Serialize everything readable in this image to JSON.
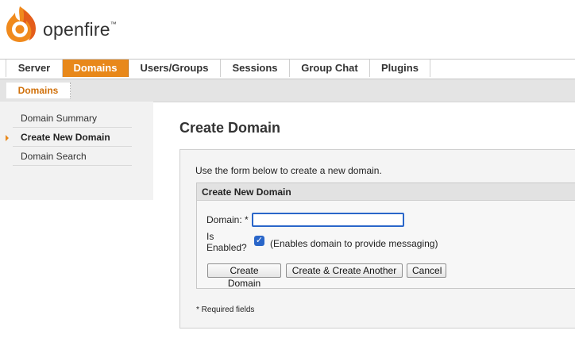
{
  "brand": {
    "name": "openfire",
    "trademark": "™"
  },
  "nav": {
    "tabs": [
      {
        "label": "Server"
      },
      {
        "label": "Domains"
      },
      {
        "label": "Users/Groups"
      },
      {
        "label": "Sessions"
      },
      {
        "label": "Group Chat"
      },
      {
        "label": "Plugins"
      }
    ],
    "active_tab": "Domains",
    "subtabs": [
      {
        "label": "Domains"
      }
    ]
  },
  "sidebar": {
    "items": [
      {
        "label": "Domain Summary"
      },
      {
        "label": "Create New Domain"
      },
      {
        "label": "Domain Search"
      }
    ],
    "active_item": "Create New Domain"
  },
  "main": {
    "title": "Create Domain",
    "intro": "Use the form below to create a new domain.",
    "form": {
      "heading": "Create New Domain",
      "domain_label": "Domain: *",
      "domain_value": "",
      "enabled_label": "Is Enabled?",
      "enabled_checked": true,
      "enabled_desc": "(Enables domain to provide messaging)",
      "buttons": {
        "create": "Create Domain",
        "create_another": "Create & Create Another",
        "cancel": "Cancel"
      }
    },
    "required_note": "* Required fields"
  },
  "colors": {
    "accent": "#e8881a",
    "focus": "#2a66c9"
  },
  "icons": {
    "logo": "openfire-flame-icon",
    "active_item_marker": "arrow-right-icon",
    "checkbox": "checkmark-icon"
  }
}
